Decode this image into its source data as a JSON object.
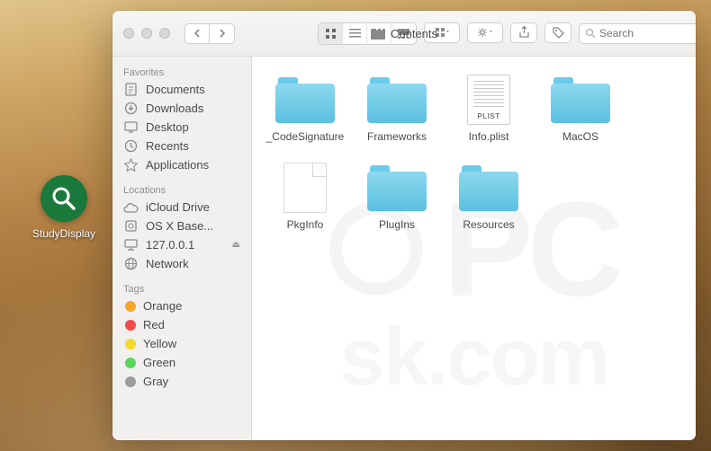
{
  "desktop": {
    "app_icon_name": "StudyDisplay"
  },
  "window": {
    "title": "Contents",
    "search_placeholder": "Search"
  },
  "sidebar": {
    "favorites_title": "Favorites",
    "favorites": [
      {
        "icon": "doc",
        "label": "Documents"
      },
      {
        "icon": "down",
        "label": "Downloads"
      },
      {
        "icon": "desktop",
        "label": "Desktop"
      },
      {
        "icon": "recents",
        "label": "Recents"
      },
      {
        "icon": "apps",
        "label": "Applications"
      }
    ],
    "locations_title": "Locations",
    "locations": [
      {
        "icon": "cloud",
        "label": "iCloud Drive"
      },
      {
        "icon": "disk",
        "label": "OS X Base...",
        "eject": false
      },
      {
        "icon": "monitor",
        "label": "127.0.0.1",
        "eject": true
      },
      {
        "icon": "globe",
        "label": "Network"
      }
    ],
    "tags_title": "Tags",
    "tags": [
      {
        "color": "#f5a623",
        "label": "Orange"
      },
      {
        "color": "#f24a4a",
        "label": "Red"
      },
      {
        "color": "#f5d927",
        "label": "Yellow"
      },
      {
        "color": "#5bd65b",
        "label": "Green"
      },
      {
        "color": "#9b9b9b",
        "label": "Gray"
      }
    ]
  },
  "files": [
    {
      "type": "folder",
      "name": "_CodeSignature"
    },
    {
      "type": "folder",
      "name": "Frameworks"
    },
    {
      "type": "plist",
      "name": "Info.plist"
    },
    {
      "type": "folder",
      "name": "MacOS"
    },
    {
      "type": "blank",
      "name": "PkgInfo"
    },
    {
      "type": "folder",
      "name": "PlugIns"
    },
    {
      "type": "folder",
      "name": "Resources"
    }
  ]
}
